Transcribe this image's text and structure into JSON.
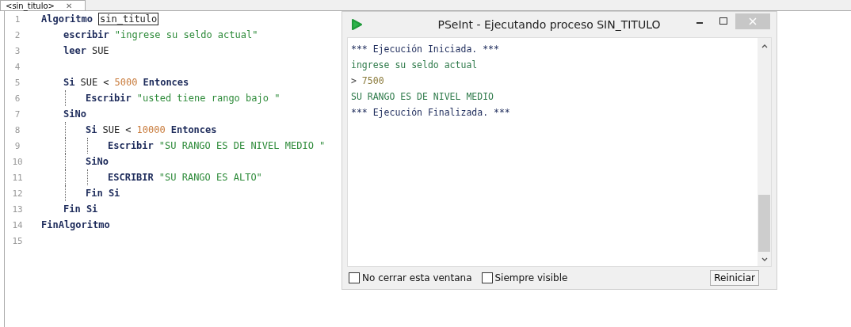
{
  "tab": {
    "label": "<sin_titulo>",
    "close": "✕"
  },
  "code": [
    {
      "number": "1",
      "tokens": [
        {
          "kind": "keyword",
          "text": "Algoritmo"
        },
        {
          "kind": "boxed",
          "text": "sin_titulo"
        }
      ],
      "children": [
        {
          "number": "2",
          "tokens": [
            {
              "kind": "keyword",
              "text": "escribir"
            },
            {
              "kind": "string",
              "text": "\"ingrese su seldo actual\""
            }
          ]
        },
        {
          "number": "3",
          "tokens": [
            {
              "kind": "keyword",
              "text": "leer"
            },
            {
              "kind": "ident",
              "text": "SUE"
            }
          ]
        },
        {
          "number": "4"
        },
        {
          "number": "5",
          "tokens": [
            {
              "kind": "keyword",
              "text": "Si"
            },
            {
              "kind": "ident",
              "text": "SUE <"
            },
            {
              "kind": "number",
              "text": "5000"
            },
            {
              "kind": "keyword",
              "text": "Entonces"
            }
          ],
          "children": [
            {
              "number": "6",
              "tokens": [
                {
                  "kind": "keyword",
                  "text": "Escribir"
                },
                {
                  "kind": "string",
                  "text": "\"usted tiene rango bajo \""
                }
              ]
            }
          ]
        },
        {
          "number": "7",
          "tokens": [
            {
              "kind": "keyword",
              "text": "SiNo"
            }
          ],
          "children": [
            {
              "number": "8",
              "tokens": [
                {
                  "kind": "keyword",
                  "text": "Si"
                },
                {
                  "kind": "ident",
                  "text": "SUE <"
                },
                {
                  "kind": "number",
                  "text": "10000"
                },
                {
                  "kind": "keyword",
                  "text": "Entonces"
                }
              ],
              "children": [
                {
                  "number": "9",
                  "tokens": [
                    {
                      "kind": "keyword",
                      "text": "Escribir"
                    },
                    {
                      "kind": "string",
                      "text": "\"SU RANGO ES DE NIVEL MEDIO \""
                    }
                  ]
                }
              ]
            },
            {
              "number": "10",
              "tokens": [
                {
                  "kind": "keyword",
                  "text": "SiNo"
                }
              ],
              "children": [
                {
                  "number": "11",
                  "tokens": [
                    {
                      "kind": "keyword",
                      "text": "ESCRIBIR"
                    },
                    {
                      "kind": "string",
                      "text": "\"SU RANGO ES ALTO\""
                    }
                  ]
                }
              ]
            },
            {
              "number": "12",
              "tokens": [
                {
                  "kind": "keyword",
                  "text": "Fin Si"
                }
              ]
            }
          ]
        },
        {
          "number": "13",
          "tokens": [
            {
              "kind": "keyword",
              "text": "Fin Si"
            }
          ]
        }
      ]
    },
    {
      "number": "14",
      "tokens": [
        {
          "kind": "keyword",
          "text": "FinAlgoritmo"
        }
      ]
    },
    {
      "number": "15"
    }
  ],
  "console_window": {
    "title": "PSeInt - Ejecutando proceso SIN_TITULO",
    "lines": [
      {
        "kind": "info",
        "text": "*** Ejecución Iniciada. ***"
      },
      {
        "kind": "output",
        "text": "ingrese su seldo actual"
      },
      {
        "kind": "input",
        "prompt": ">",
        "text": "7500"
      },
      {
        "kind": "output",
        "text": "SU RANGO ES DE NIVEL MEDIO"
      },
      {
        "kind": "info",
        "text": "*** Ejecución Finalizada. ***"
      }
    ],
    "checkboxes": [
      {
        "label": "No cerrar esta ventana",
        "checked": false
      },
      {
        "label": "Siempre visible",
        "checked": false
      }
    ],
    "button": "Reiniciar"
  }
}
